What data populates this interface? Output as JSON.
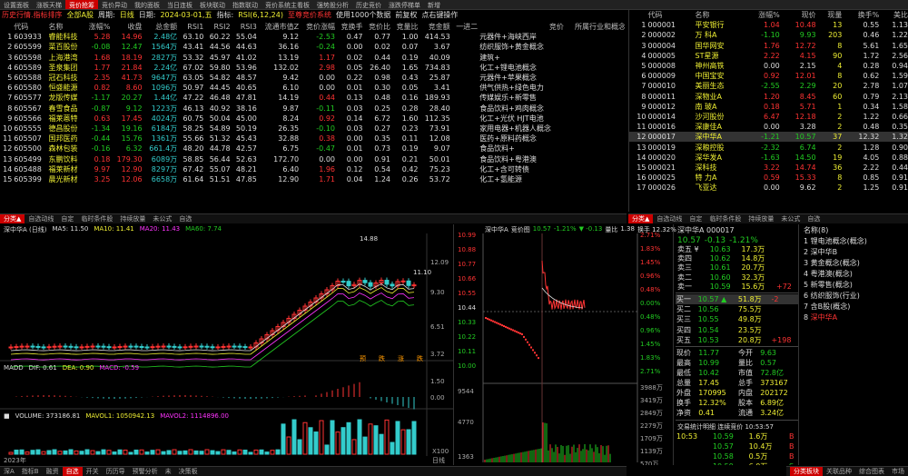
{
  "topbar": [
    "设置面板",
    "涨板天梯",
    "竞价抢筹",
    "竞价异动",
    "我的面板",
    "当日连板",
    "板块联动",
    "指数联动",
    "竞价系统主看板",
    "强势股分析",
    "历史竞价",
    "涨跌停梯单",
    "新增"
  ],
  "title": {
    "name": "历史行情.指标排序",
    "market": "全部A股",
    "period_lbl": "周期:",
    "period": "日线",
    "date_lbl": "日期:",
    "date": "2024-03-01,五",
    "ind_lbl": "指标:",
    "ind": "RSI(6,12,24)",
    "sys": "至尊竞价系统",
    "note": "使用1000个数据",
    "note2": "前复权",
    "note3": "点右键操作"
  },
  "table": {
    "headers": [
      "代码",
      "名称",
      "涨幅%",
      "收盘",
      "总金额",
      "RSI1",
      "RSI2",
      "RSI3",
      "流通市值Z",
      "竞价涨幅",
      "竞换手",
      "竞价比",
      "竞量比",
      "竞金额",
      "一进二",
      "竞价",
      "所属行业和概念"
    ],
    "rows": [
      [
        "1",
        "603933",
        "睿能科技",
        "5.28",
        "14.96",
        "2.48亿",
        "63.10",
        "60.22",
        "55.04",
        "9.12",
        "-2.53",
        "0.47",
        "0.77",
        "1.00",
        "414.53",
        "",
        "元器件+海峡西岸"
      ],
      [
        "2",
        "605599",
        "菜百股份",
        "-0.08",
        "12.47",
        "1564万",
        "43.41",
        "44.56",
        "44.63",
        "36.16",
        "-0.24",
        "0.00",
        "0.02",
        "0.07",
        "3.67",
        "",
        "纺织服饰+黄金概念"
      ],
      [
        "3",
        "605598",
        "上海港湾",
        "1.68",
        "18.19",
        "2827万",
        "53.32",
        "45.97",
        "41.02",
        "13.19",
        "1.17",
        "0.02",
        "0.44",
        "0.19",
        "40.09",
        "",
        "建筑+"
      ],
      [
        "4",
        "605589",
        "圣泉集团",
        "1.77",
        "21.84",
        "2.24亿",
        "67.02",
        "59.80",
        "53.96",
        "132.02",
        "2.98",
        "0.05",
        "26.40",
        "1.65",
        "734.83",
        "",
        "化工+锂电池概念"
      ],
      [
        "5",
        "605588",
        "冠石科技",
        "2.35",
        "41.73",
        "9647万",
        "63.05",
        "54.82",
        "48.57",
        "9.42",
        "0.00",
        "0.22",
        "0.98",
        "0.43",
        "25.87",
        "",
        "元器件+苹果概念"
      ],
      [
        "6",
        "605580",
        "恒盛能源",
        "0.82",
        "8.60",
        "1096万",
        "50.97",
        "44.45",
        "40.65",
        "6.10",
        "0.00",
        "0.01",
        "0.30",
        "0.05",
        "3.41",
        "",
        "供气供热+绿色电力"
      ],
      [
        "7",
        "605577",
        "龙版传媒",
        "-1.17",
        "20.27",
        "1.44亿",
        "47.22",
        "46.48",
        "47.81",
        "14.19",
        "0.44",
        "0.13",
        "0.48",
        "0.16",
        "189.93",
        "",
        "传媒娱乐+新零售"
      ],
      [
        "8",
        "605567",
        "春雪食品",
        "-0.87",
        "9.12",
        "1223万",
        "46.13",
        "40.92",
        "38.16",
        "9.87",
        "-0.11",
        "0.03",
        "0.25",
        "0.28",
        "28.40",
        "",
        "食品饮料+鸡肉概念"
      ],
      [
        "9",
        "605566",
        "福莱蒽特",
        "0.63",
        "17.45",
        "4024万",
        "60.75",
        "50.04",
        "45.00",
        "8.24",
        "0.92",
        "0.14",
        "6.72",
        "1.60",
        "112.35",
        "",
        "化工+光伏 HJT电池"
      ],
      [
        "10",
        "605555",
        "德昌股份",
        "-1.34",
        "19.16",
        "6184万",
        "58.25",
        "54.89",
        "50.19",
        "26.35",
        "-0.10",
        "0.03",
        "0.27",
        "0.23",
        "73.91",
        "",
        "家用电器+机器人概念"
      ],
      [
        "11",
        "605507",
        "国邦医药",
        "-0.44",
        "15.76",
        "1361万",
        "55.66",
        "51.32",
        "45.43",
        "32.88",
        "0.38",
        "0.00",
        "0.35",
        "0.11",
        "12.08",
        "",
        "医药+原料药概念"
      ],
      [
        "12",
        "605500",
        "森林包装",
        "-0.16",
        "6.32",
        "661.4万",
        "48.20",
        "44.78",
        "42.57",
        "6.75",
        "-0.47",
        "0.01",
        "0.73",
        "0.19",
        "9.07",
        "",
        "食品饮料+"
      ],
      [
        "13",
        "605499",
        "东鹏饮料",
        "0.18",
        "179.30",
        "6089万",
        "58.85",
        "56.44",
        "52.63",
        "172.70",
        "0.00",
        "0.00",
        "0.91",
        "0.21",
        "50.01",
        "",
        "食品饮料+粤港澳"
      ],
      [
        "14",
        "605488",
        "福莱新材",
        "9.97",
        "12.90",
        "8297万",
        "67.42",
        "55.07",
        "48.21",
        "6.40",
        "1.96",
        "0.12",
        "0.54",
        "0.42",
        "75.23",
        "",
        "化工+含可转债"
      ],
      [
        "15",
        "605399",
        "晨光新材",
        "3.25",
        "12.06",
        "6658万",
        "61.64",
        "51.51",
        "47.85",
        "12.90",
        "1.71",
        "0.04",
        "1.24",
        "0.26",
        "53.72",
        "",
        "化工+氢能源"
      ]
    ]
  },
  "rtable": {
    "headers": [
      "代码",
      "名称",
      "涨幅%",
      "现价",
      "现量",
      "换手%",
      "美比"
    ],
    "rows": [
      [
        "1",
        "000001",
        "平安银行",
        "1.04",
        "10.48",
        "13",
        "0.55",
        "1.13"
      ],
      [
        "2",
        "000002",
        "万 科A",
        "-1.10",
        "9.93",
        "203",
        "0.46",
        "1.22"
      ],
      [
        "3",
        "000004",
        "国华网安",
        "1.76",
        "12.72",
        "8",
        "5.61",
        "1.65"
      ],
      [
        "4",
        "000005",
        "ST星源",
        "2.22",
        "4.15",
        "90",
        "1.72",
        "2.56"
      ],
      [
        "5",
        "000008",
        "神州高铁",
        "0.00",
        "2.15",
        "4",
        "0.28",
        "0.94"
      ],
      [
        "6",
        "000009",
        "中国宝安",
        "0.92",
        "12.01",
        "8",
        "0.62",
        "1.59"
      ],
      [
        "7",
        "000010",
        "美丽生态",
        "-2.55",
        "2.29",
        "20",
        "2.78",
        "1.07"
      ],
      [
        "8",
        "000011",
        "深物业A",
        "1.20",
        "8.45",
        "60",
        "0.79",
        "2.13"
      ],
      [
        "9",
        "000012",
        "南 玻A",
        "0.18",
        "5.71",
        "1",
        "0.34",
        "1.58"
      ],
      [
        "10",
        "000014",
        "沙河股份",
        "6.47",
        "12.18",
        "2",
        "1.22",
        "0.66"
      ],
      [
        "11",
        "000016",
        "深康佳A",
        "0.00",
        "3.28",
        "2",
        "0.48",
        "0.35"
      ],
      [
        "12",
        "000017",
        "深中华A",
        "-1.21",
        "10.57",
        "37",
        "12.32",
        "1.32"
      ],
      [
        "13",
        "000019",
        "深粮控股",
        "-2.32",
        "6.74",
        "2",
        "1.28",
        "0.90"
      ],
      [
        "14",
        "000020",
        "深华发A",
        "-1.63",
        "14.50",
        "19",
        "4.05",
        "0.88"
      ],
      [
        "15",
        "000021",
        "深科技",
        "3.22",
        "14.74",
        "36",
        "2.22",
        "0.44"
      ],
      [
        "16",
        "000025",
        "特 力A",
        "0.59",
        "15.33",
        "8",
        "0.85",
        "0.91"
      ],
      [
        "17",
        "000026",
        "飞亚达",
        "0.00",
        "9.62",
        "2",
        "1.25",
        "0.91"
      ]
    ]
  },
  "lefttabs": [
    "分类▲",
    "自选动线",
    "自定",
    "临时条件股",
    "持续放量",
    "未公式",
    "自选"
  ],
  "righttabs": [
    "分类▲",
    "自选动线",
    "自定",
    "临时条件股",
    "持续放量",
    "未公式",
    "自选"
  ],
  "kline": {
    "title": "深中华A (日线)",
    "ma5": "MA5: 11.50",
    "ma10": "MA10: 11.41",
    "ma20": "MA20: 11.43",
    "ma60": "MA60: 7.74",
    "hi": "14.88",
    "last": "11.10",
    "yticks": [
      "12.09",
      "9.30",
      "6.51",
      "3.72"
    ],
    "macd": "MADD",
    "dif": "DIF: 0.61",
    "dea": "DEA: 0.90",
    "macdv": "MACD: -0.59",
    "macdticks": [
      "1.50",
      "0.00"
    ],
    "vol": "VOLUME: 373186.81",
    "mavol1": "MAVOL1: 1050942.13",
    "mavol2": "MAVOL2: 1114896.00",
    "year": "2023年",
    "xmark": "日线",
    "x100": "X100",
    "marks": [
      "预",
      "跌",
      "涨",
      "跌"
    ]
  },
  "intraday": {
    "title": "深中华A",
    "sub": "竞价图",
    "price": "10.57",
    "pct": "-1.21%",
    "chg": "▼ -0.13",
    "vol_lbl": "量比",
    "vol": "1.38",
    "turn": "换手 12.32%",
    "yl": [
      "10.99",
      "10.88",
      "10.77",
      "10.66",
      "10.55",
      "10.44",
      "10.33",
      "10.22",
      "10.11",
      "10.00",
      "9544",
      "4770",
      "1363"
    ],
    "yr": [
      "2.71%",
      "1.83%",
      "1.45%",
      "0.96%",
      "0.48%",
      "0.00%",
      "0.48%",
      "0.96%",
      "1.45%",
      "1.83%",
      "2.71%",
      "3988万",
      "3419万",
      "2849万",
      "2279万",
      "1709万",
      "1139万",
      "570万"
    ],
    "xt": [
      "09:30",
      "10:30",
      "13:00"
    ]
  },
  "quote": {
    "title": "深中华A",
    "code": "000017",
    "price": "10.57",
    "chg": "-0.13",
    "pct": "-1.21%",
    "asks": [
      [
        "卖五 ¥",
        "10.63",
        "17.3万"
      ],
      [
        "卖四",
        "10.62",
        "14.8万"
      ],
      [
        "卖三",
        "10.61",
        "20.7万"
      ],
      [
        "卖二",
        "10.60",
        "32.3万"
      ],
      [
        "卖一",
        "10.59",
        "15.6万",
        "+72"
      ]
    ],
    "bids": [
      [
        "买一",
        "10.57 ▲",
        "51.8万",
        "-2"
      ],
      [
        "买二",
        "10.56",
        "75.5万"
      ],
      [
        "买三",
        "10.55",
        "49.8万"
      ],
      [
        "买四",
        "10.54",
        "23.5万"
      ],
      [
        "买五",
        "10.53",
        "20.8万",
        "+198"
      ]
    ],
    "stats": [
      [
        "现价",
        "11.77",
        "今开",
        "9.63"
      ],
      [
        "最高",
        "10.99",
        "量比",
        "0.57"
      ],
      [
        "最低",
        "10.42",
        "市值",
        "72.8亿"
      ],
      [
        "总量",
        "17.45",
        "总手",
        "373167"
      ],
      [
        "外盘",
        "170995",
        "内盘",
        "202172"
      ],
      [
        "换手",
        "12.32%",
        "股本",
        "6.89亿"
      ],
      [
        "净资",
        "0.41",
        "流通",
        "3.24亿"
      ]
    ],
    "ticks_title": "交易统计明细",
    "ticks_time": "连续竞价 10:53:57",
    "ticks": [
      [
        "10:53",
        "10.59",
        "1.6万",
        "B"
      ],
      [
        "",
        "10.57",
        "10.4万",
        "B"
      ],
      [
        "",
        "10.58",
        "0.5万",
        "B"
      ],
      [
        "",
        "10.59",
        "6.0万",
        "S"
      ],
      [
        "",
        "10.57",
        "35.1万",
        "S"
      ],
      [
        "",
        "10.58",
        "1.9万",
        "S"
      ]
    ]
  },
  "concepts": {
    "title": "名称(8)",
    "items": [
      "锂电池概念(概念)",
      "深中华B",
      "黄金概念(概念)",
      "粤港澳(概念)",
      "新零售(概念)",
      "纺织服饰(行业)",
      "含B股(概念)",
      "深中华A"
    ]
  },
  "bottomtabs": [
    "深A",
    "指标B",
    "融资",
    "自选",
    "开关",
    "历历导",
    "预警分析",
    "未",
    "决策板"
  ],
  "bottomright": [
    "分类板块",
    "关联品种",
    "综合图表",
    "市场"
  ]
}
